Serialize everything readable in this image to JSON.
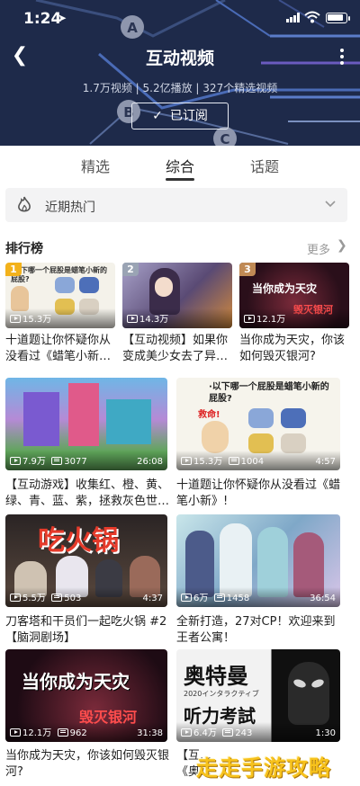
{
  "status_bar": {
    "time": "1:24"
  },
  "header": {
    "title": "互动视频",
    "stats": "1.7万视频 | 5.2亿播放 | 327个精选视频",
    "subscribe_label": "已订阅",
    "deco_letters": [
      "A",
      "B",
      "C"
    ]
  },
  "tabs": [
    {
      "label": "精选",
      "active": false
    },
    {
      "label": "综合",
      "active": true
    },
    {
      "label": "话题",
      "active": false
    }
  ],
  "hot_dropdown": {
    "label": "近期热门"
  },
  "ranking": {
    "title": "排行榜",
    "more_label": "更多",
    "items": [
      {
        "rank": "1",
        "views": "15.3万",
        "title": "十道题让你怀疑你从没看过《蜡笔小新…",
        "badge_color": "#f3b21b",
        "thumb_text": "·以下哪一个屁股是蜡笔小新的屁股?"
      },
      {
        "rank": "2",
        "views": "14.3万",
        "title": "【互动视频】如果你变成美少女去了异…",
        "badge_color": "#9aa4b4"
      },
      {
        "rank": "3",
        "views": "12.1万",
        "title": "当你成为天灾，你该如何毁灭银河?",
        "badge_color": "#c08a55",
        "thumb_text": "当你成为天灾",
        "thumb_text2": "毁灭银河"
      }
    ]
  },
  "feed": [
    {
      "views": "7.9万",
      "danmaku": "3077",
      "duration": "26:08",
      "title": "【互动游戏】收集红、橙、黄、绿、青、蓝、紫，拯救灰色世…"
    },
    {
      "views": "15.3万",
      "danmaku": "1004",
      "duration": "4:57",
      "title": "十道题让你怀疑你从没看过《蜡笔小新》!",
      "thumb_text": "·以下哪一个屁股是蜡笔小新的屁股?",
      "thumb_text2": "救命!"
    },
    {
      "views": "5.5万",
      "danmaku": "503",
      "duration": "4:37",
      "title": "刀客塔和干员们一起吃火锅 #2【脑洞剧场】",
      "thumb_text": "吃火锅"
    },
    {
      "views": "6万",
      "danmaku": "1458",
      "duration": "36:54",
      "title": "全新打造，27对CP！欢迎来到王者公寓！"
    },
    {
      "views": "12.1万",
      "danmaku": "962",
      "duration": "31:38",
      "title": "当你成为天灾，你该如何毁灭银河?",
      "thumb_text": "当你成为天灾",
      "thumb_text2": "毁灭银河"
    },
    {
      "views": "6.4万",
      "danmaku": "243",
      "duration": "1:30",
      "title": "【互…",
      "title2": "《奥…",
      "thumb_text": "奥特曼",
      "thumb_text2": "听力考試",
      "thumb_text3": "2020インタラクティブ"
    }
  ],
  "watermark": "走走手游攻略",
  "colors": {
    "header_bg": "#1e2a4a",
    "accent_line": "#5b7cc9",
    "gold": "#f3b21b"
  }
}
